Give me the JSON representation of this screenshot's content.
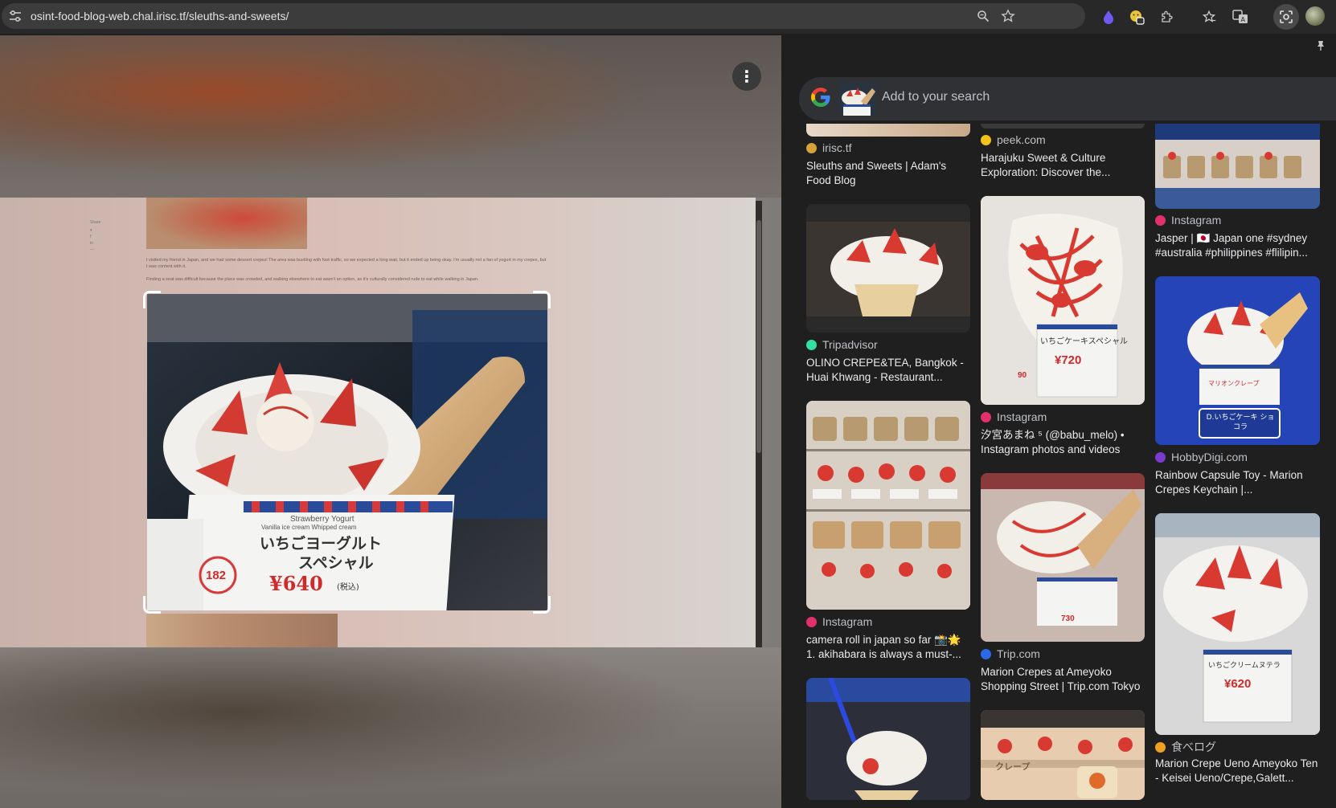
{
  "browser": {
    "url": "osint-food-blog-web.chal.irisc.tf/sleuths-and-sweets/"
  },
  "icons": [
    "tune-icon",
    "zoom-icon",
    "bookmark-star-icon",
    "extension-drop-icon",
    "extension-emoji-icon",
    "puzzle-icon",
    "favorites-icon",
    "translate-icon",
    "lens-icon",
    "profile-avatar",
    "more-vert-icon",
    "pin-icon",
    "google-logo"
  ],
  "colors": {
    "panel_bg": "#1f1f1f",
    "searchbar_bg": "#303134",
    "text_primary": "#e8eaed",
    "text_secondary": "#bdc1c6"
  },
  "blog": {
    "paragraph1": "I visited my friend in Japan, and we had some dessert crepes! The area was bustling with foot traffic, so we expected a long wait, but it ended up being okay. I'm usually not a fan of yogurt in my crepes, but I was content with it.",
    "paragraph2": "Finding a seat was difficult because the place was crowded, and walking elsewhere to eat wasn't an option, as it's culturally considered rude to eat while walking in Japan.",
    "share": "Share",
    "sign_top": "Strawberry Yogurt",
    "sign_sub": "Vanilla ice cream Whipped cream",
    "sign_jp_line1": "いちごヨーグルト",
    "sign_jp_line2": "スペシャル",
    "sign_price": "¥640",
    "sign_tax": "(税込)",
    "sign_number": "182"
  },
  "lens": {
    "search_placeholder": "Add to your search",
    "results": [
      {
        "source": "irisc.tf",
        "title": "Sleuths and Sweets | Adam's Food Blog",
        "fav": "#d6a23a"
      },
      {
        "source": "peek.com",
        "title": "Harajuku Sweet & Culture Exploration: Discover the...",
        "fav": "#f2c21a"
      },
      {
        "source": "Instagram",
        "title": "Jasper | 🇯🇵 Japan one #sydney #australia #philippines #flilipin...",
        "fav": "#e1306c"
      },
      {
        "source": "Tripadvisor",
        "title": "OLINO CREPE&TEA, Bangkok - Huai Khwang - Restaurant...",
        "fav": "#34e0a1"
      },
      {
        "source": "Instagram",
        "title": "汐宮あまね ⁵ (@babu_melo) • Instagram photos and videos",
        "fav": "#e1306c"
      },
      {
        "source": "HobbyDigi.com",
        "title": "Rainbow Capsule Toy - Marion Crepes Keychain |...",
        "fav": "#7a3bd0"
      },
      {
        "source": "Instagram",
        "title": "camera roll in japan so far 📸🌟 1. akihabara is always a must-...",
        "fav": "#e1306c"
      },
      {
        "source": "Trip.com",
        "title": "Marion Crepes at Ameyoko Shopping Street | Trip.com Tokyo",
        "fav": "#2a6ae9"
      },
      {
        "source": "食べログ",
        "title": "Marion Crepe Ueno Ameyoko Ten - Keisei Ueno/Crepe,Galett...",
        "fav": "#f0a020"
      }
    ],
    "labels": {
      "r_price_720": "¥720",
      "r_jp_720": "いちごケーキスペシャル",
      "r_num_90": "90",
      "r_price_620": "¥620",
      "r_jp_620": "いちごクリームヌテラ",
      "r_box_jp": "D.いちごケーキ ショコラ",
      "r_box_brand": "マリオンクレープ",
      "r_price_730": "730",
      "r_crepe_sign": "クレープ"
    }
  }
}
